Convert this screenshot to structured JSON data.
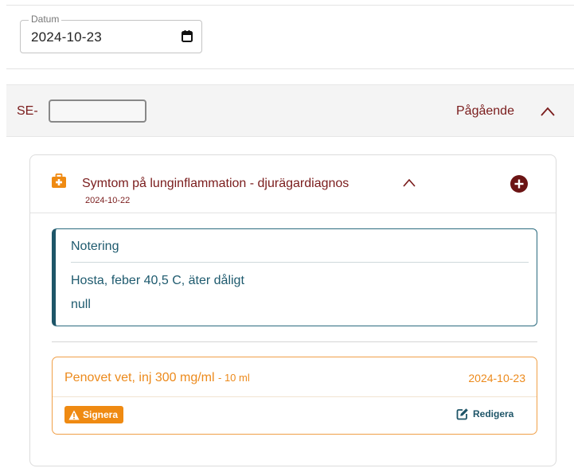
{
  "date_filter": {
    "label": "Datum",
    "value": "2024-10-23",
    "icon": "calendar-icon"
  },
  "case": {
    "id_prefix": "SE-",
    "status": "Pågående",
    "chevron": "chevron-up-icon"
  },
  "diagnosis": {
    "icon": "medical-kit-icon",
    "title": "Symtom på lunginflammation - djurägardiagnos",
    "date": "2024-10-22",
    "add_icon": "plus-circle-icon"
  },
  "note": {
    "title": "Notering",
    "text": "Hosta, feber 40,5 C, äter dåligt",
    "text2": "null"
  },
  "prescription": {
    "name": "Penovet vet, inj 300 mg/ml",
    "quantity": "- 10 ml",
    "date": "2024-10-23",
    "sign_label": "Signera",
    "edit_label": "Redigera"
  },
  "colors": {
    "maroon": "#7a1c1c",
    "teal": "#1e5568",
    "orange": "#ef8a12"
  }
}
